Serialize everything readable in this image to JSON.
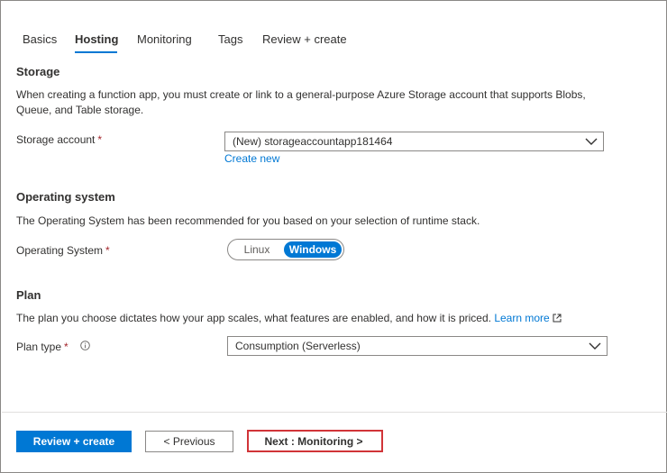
{
  "tabs": [
    {
      "label": "Basics"
    },
    {
      "label": "Hosting"
    },
    {
      "label": "Monitoring"
    },
    {
      "label": "Tags"
    },
    {
      "label": "Review + create"
    }
  ],
  "storage": {
    "title": "Storage",
    "description": "When creating a function app, you must create or link to a general-purpose Azure Storage account that supports Blobs, Queue, and Table storage.",
    "field_label": "Storage account",
    "required_mark": "*",
    "selected_value": "(New) storageaccountapp181464",
    "create_new_label": "Create new"
  },
  "os": {
    "title": "Operating system",
    "description": "The Operating System has been recommended for you based on your selection of runtime stack.",
    "field_label": "Operating System",
    "required_mark": "*",
    "options": [
      "Linux",
      "Windows"
    ],
    "selected": "Windows"
  },
  "plan": {
    "title": "Plan",
    "description": "The plan you choose dictates how your app scales, what features are enabled, and how it is priced.",
    "learn_more_label": "Learn more",
    "field_label": "Plan type",
    "required_mark": "*",
    "selected_value": "Consumption (Serverless)"
  },
  "footer": {
    "review_create_label": "Review + create",
    "previous_label": "< Previous",
    "next_label": "Next : Monitoring >"
  },
  "colors": {
    "accent": "#0078d4",
    "required": "#a4262c",
    "highlight": "#d13438"
  }
}
